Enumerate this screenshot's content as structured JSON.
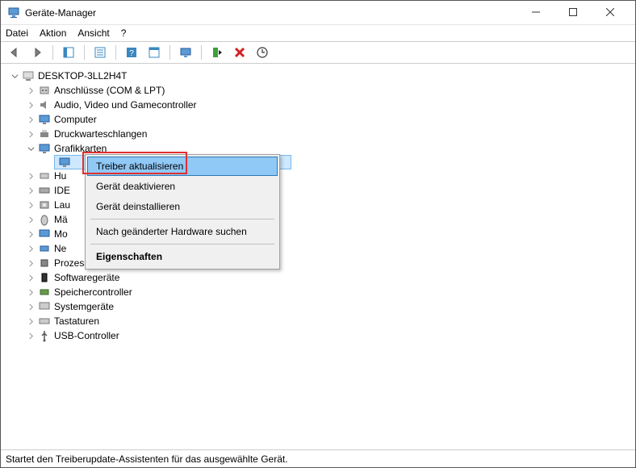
{
  "window": {
    "title": "Geräte-Manager"
  },
  "menubar": {
    "file": "Datei",
    "action": "Aktion",
    "view": "Ansicht",
    "help": "?"
  },
  "tree": {
    "root": "DESKTOP-3LL2H4T",
    "items": [
      {
        "label": "Anschlüsse (COM & LPT)"
      },
      {
        "label": "Audio, Video und Gamecontroller"
      },
      {
        "label": "Computer"
      },
      {
        "label": "Druckwarteschlangen"
      },
      {
        "label": "Grafikkarten"
      },
      {
        "label": "Hu"
      },
      {
        "label": "IDE"
      },
      {
        "label": "Lau"
      },
      {
        "label": "Mä"
      },
      {
        "label": "Mo"
      },
      {
        "label": "Ne"
      },
      {
        "label": "Prozessoren"
      },
      {
        "label": "Softwaregeräte"
      },
      {
        "label": "Speichercontroller"
      },
      {
        "label": "Systemgeräte"
      },
      {
        "label": "Tastaturen"
      },
      {
        "label": "USB-Controller"
      }
    ]
  },
  "context_menu": {
    "update_driver": "Treiber aktualisieren",
    "disable_device": "Gerät deaktivieren",
    "uninstall_device": "Gerät deinstallieren",
    "scan_hardware": "Nach geänderter Hardware suchen",
    "properties": "Eigenschaften"
  },
  "statusbar": {
    "text": "Startet den Treiberupdate-Assistenten für das ausgewählte Gerät."
  }
}
